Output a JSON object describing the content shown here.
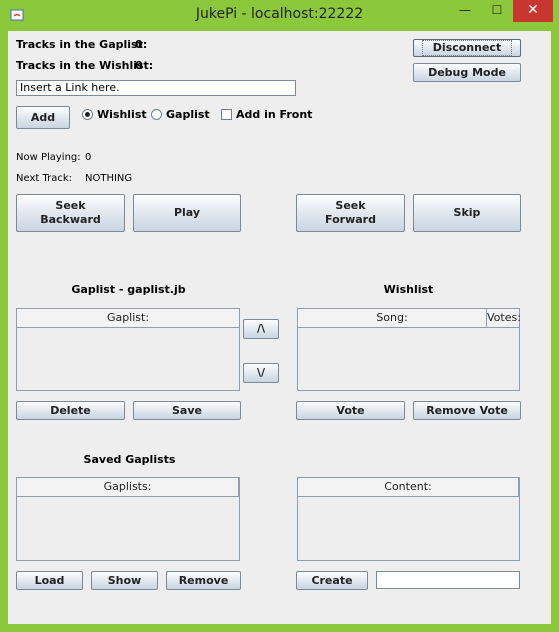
{
  "window": {
    "title": "JukePi - localhost:22222",
    "minimize": "—",
    "maximize": "☐",
    "close": "✕"
  },
  "status": {
    "gaplist_tracks_label": "Tracks in the Gaplist:",
    "gaplist_tracks_value": "0",
    "wishlist_tracks_label": "Tracks in the Wishlist:",
    "wishlist_tracks_value": "0",
    "now_playing_label": "Now Playing:",
    "now_playing_value": "0",
    "next_track_label": "Next Track:",
    "next_track_value": "NOTHING"
  },
  "top_buttons": {
    "disconnect": "Disconnect",
    "debug_mode": "Debug Mode"
  },
  "add_row": {
    "link_value": "Insert a Link here.",
    "add_label": "Add",
    "wishlist_label": "Wishlist",
    "wishlist_selected": true,
    "gaplist_label": "Gaplist",
    "gaplist_selected": false,
    "front_label": "Add in Front",
    "front_checked": false
  },
  "playback": {
    "seek_backward_line1": "Seek",
    "seek_backward_line2": "Backward",
    "play": "Play",
    "seek_forward_line1": "Seek",
    "seek_forward_line2": "Forward",
    "skip": "Skip"
  },
  "gaplist": {
    "title": "Gaplist - gaplist.jb",
    "column": "Gaplist:",
    "up": "/\\",
    "down": "\\/",
    "delete": "Delete",
    "save": "Save"
  },
  "wishlist": {
    "title": "Wishlist",
    "columns": [
      "Song:",
      "Votes:"
    ],
    "vote": "Vote",
    "remove_vote": "Remove Vote"
  },
  "saved": {
    "title": "Saved Gaplists",
    "column": "Gaplists:",
    "load": "Load",
    "show": "Show",
    "remove": "Remove"
  },
  "content": {
    "column": "Content:",
    "create": "Create",
    "name_value": ""
  },
  "colors": {
    "frame": "#8cc83c",
    "close": "#c7372f",
    "panel": "#eeeeee"
  }
}
